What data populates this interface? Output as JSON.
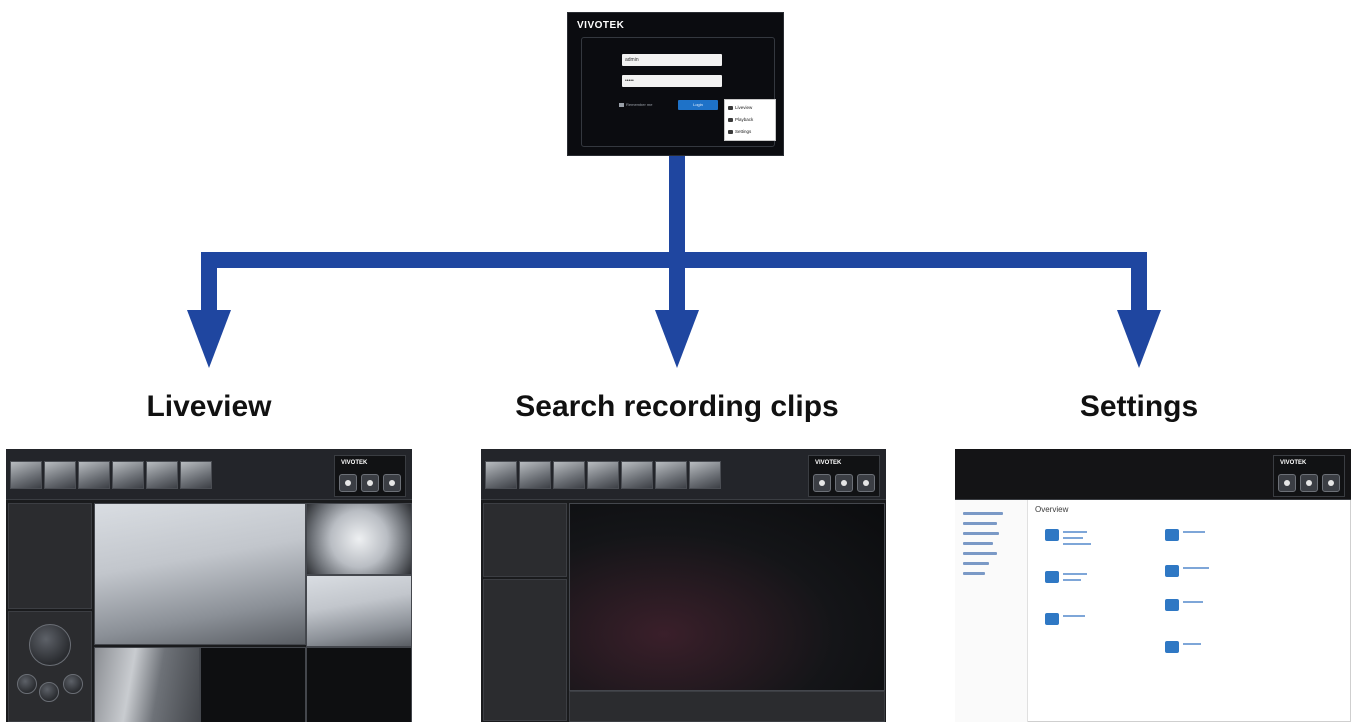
{
  "captions": {
    "liveview": "Liveview",
    "search": "Search recording clips",
    "settings": "Settings"
  },
  "colors": {
    "arrow": "#1f46a0",
    "caption": "#111111",
    "login_background": "#0b0c10",
    "login_button": "#1e72c8"
  },
  "login": {
    "logo": "VIVOTEK",
    "username": "admin",
    "password": "•••••",
    "remember": "Remember me",
    "login_button": "Login",
    "menu": [
      "Liveview",
      "Playback",
      "Settings"
    ]
  },
  "screens": {
    "liveview": {
      "brand": "VIVOTEK"
    },
    "search": {
      "brand": "VIVOTEK"
    },
    "settings": {
      "brand": "VIVOTEK",
      "heading": "Overview"
    }
  },
  "icons": [
    "arrow-down-icon",
    "arrow-down-icon",
    "arrow-down-icon",
    "eye-icon",
    "lock-icon",
    "gear-icon"
  ]
}
